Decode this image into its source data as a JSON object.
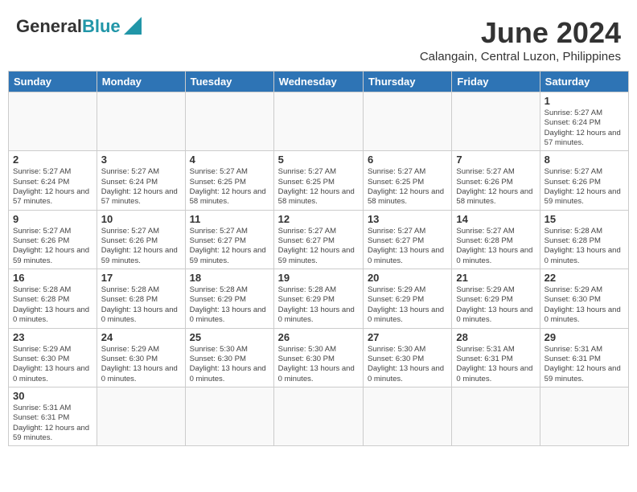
{
  "header": {
    "logo_text_regular": "General",
    "logo_text_blue": "Blue",
    "month_title": "June 2024",
    "subtitle": "Calangain, Central Luzon, Philippines"
  },
  "weekdays": [
    "Sunday",
    "Monday",
    "Tuesday",
    "Wednesday",
    "Thursday",
    "Friday",
    "Saturday"
  ],
  "weeks": [
    [
      {
        "day": "",
        "info": ""
      },
      {
        "day": "",
        "info": ""
      },
      {
        "day": "",
        "info": ""
      },
      {
        "day": "",
        "info": ""
      },
      {
        "day": "",
        "info": ""
      },
      {
        "day": "",
        "info": ""
      },
      {
        "day": "1",
        "info": "Sunrise: 5:27 AM\nSunset: 6:24 PM\nDaylight: 12 hours\nand 57 minutes."
      }
    ],
    [
      {
        "day": "2",
        "info": "Sunrise: 5:27 AM\nSunset: 6:24 PM\nDaylight: 12 hours\nand 57 minutes."
      },
      {
        "day": "3",
        "info": "Sunrise: 5:27 AM\nSunset: 6:24 PM\nDaylight: 12 hours\nand 57 minutes."
      },
      {
        "day": "4",
        "info": "Sunrise: 5:27 AM\nSunset: 6:25 PM\nDaylight: 12 hours\nand 58 minutes."
      },
      {
        "day": "5",
        "info": "Sunrise: 5:27 AM\nSunset: 6:25 PM\nDaylight: 12 hours\nand 58 minutes."
      },
      {
        "day": "6",
        "info": "Sunrise: 5:27 AM\nSunset: 6:25 PM\nDaylight: 12 hours\nand 58 minutes."
      },
      {
        "day": "7",
        "info": "Sunrise: 5:27 AM\nSunset: 6:26 PM\nDaylight: 12 hours\nand 58 minutes."
      },
      {
        "day": "8",
        "info": "Sunrise: 5:27 AM\nSunset: 6:26 PM\nDaylight: 12 hours\nand 59 minutes."
      }
    ],
    [
      {
        "day": "9",
        "info": "Sunrise: 5:27 AM\nSunset: 6:26 PM\nDaylight: 12 hours\nand 59 minutes."
      },
      {
        "day": "10",
        "info": "Sunrise: 5:27 AM\nSunset: 6:26 PM\nDaylight: 12 hours\nand 59 minutes."
      },
      {
        "day": "11",
        "info": "Sunrise: 5:27 AM\nSunset: 6:27 PM\nDaylight: 12 hours\nand 59 minutes."
      },
      {
        "day": "12",
        "info": "Sunrise: 5:27 AM\nSunset: 6:27 PM\nDaylight: 12 hours\nand 59 minutes."
      },
      {
        "day": "13",
        "info": "Sunrise: 5:27 AM\nSunset: 6:27 PM\nDaylight: 13 hours\nand 0 minutes."
      },
      {
        "day": "14",
        "info": "Sunrise: 5:27 AM\nSunset: 6:28 PM\nDaylight: 13 hours\nand 0 minutes."
      },
      {
        "day": "15",
        "info": "Sunrise: 5:28 AM\nSunset: 6:28 PM\nDaylight: 13 hours\nand 0 minutes."
      }
    ],
    [
      {
        "day": "16",
        "info": "Sunrise: 5:28 AM\nSunset: 6:28 PM\nDaylight: 13 hours\nand 0 minutes."
      },
      {
        "day": "17",
        "info": "Sunrise: 5:28 AM\nSunset: 6:28 PM\nDaylight: 13 hours\nand 0 minutes."
      },
      {
        "day": "18",
        "info": "Sunrise: 5:28 AM\nSunset: 6:29 PM\nDaylight: 13 hours\nand 0 minutes."
      },
      {
        "day": "19",
        "info": "Sunrise: 5:28 AM\nSunset: 6:29 PM\nDaylight: 13 hours\nand 0 minutes."
      },
      {
        "day": "20",
        "info": "Sunrise: 5:29 AM\nSunset: 6:29 PM\nDaylight: 13 hours\nand 0 minutes."
      },
      {
        "day": "21",
        "info": "Sunrise: 5:29 AM\nSunset: 6:29 PM\nDaylight: 13 hours\nand 0 minutes."
      },
      {
        "day": "22",
        "info": "Sunrise: 5:29 AM\nSunset: 6:30 PM\nDaylight: 13 hours\nand 0 minutes."
      }
    ],
    [
      {
        "day": "23",
        "info": "Sunrise: 5:29 AM\nSunset: 6:30 PM\nDaylight: 13 hours\nand 0 minutes."
      },
      {
        "day": "24",
        "info": "Sunrise: 5:29 AM\nSunset: 6:30 PM\nDaylight: 13 hours\nand 0 minutes."
      },
      {
        "day": "25",
        "info": "Sunrise: 5:30 AM\nSunset: 6:30 PM\nDaylight: 13 hours\nand 0 minutes."
      },
      {
        "day": "26",
        "info": "Sunrise: 5:30 AM\nSunset: 6:30 PM\nDaylight: 13 hours\nand 0 minutes."
      },
      {
        "day": "27",
        "info": "Sunrise: 5:30 AM\nSunset: 6:30 PM\nDaylight: 13 hours\nand 0 minutes."
      },
      {
        "day": "28",
        "info": "Sunrise: 5:31 AM\nSunset: 6:31 PM\nDaylight: 13 hours\nand 0 minutes."
      },
      {
        "day": "29",
        "info": "Sunrise: 5:31 AM\nSunset: 6:31 PM\nDaylight: 12 hours\nand 59 minutes."
      }
    ],
    [
      {
        "day": "30",
        "info": "Sunrise: 5:31 AM\nSunset: 6:31 PM\nDaylight: 12 hours\nand 59 minutes."
      },
      {
        "day": "",
        "info": ""
      },
      {
        "day": "",
        "info": ""
      },
      {
        "day": "",
        "info": ""
      },
      {
        "day": "",
        "info": ""
      },
      {
        "day": "",
        "info": ""
      },
      {
        "day": "",
        "info": ""
      }
    ]
  ]
}
